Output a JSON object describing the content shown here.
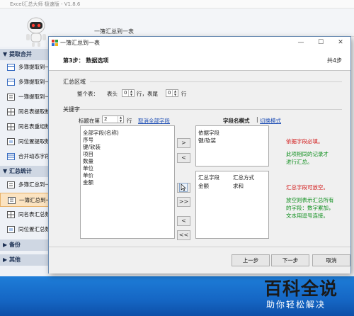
{
  "background": {
    "window_title": "Excel汇总大师 极速版 - V1.8.6",
    "page_title": "一簿汇总到一表",
    "sidebar": {
      "groups": [
        {
          "label": "▼ 提取合并"
        },
        {
          "label": "▼ 汇总统计"
        },
        {
          "label": "▶ 备份"
        },
        {
          "label": "▶ 其他"
        }
      ],
      "items": [
        {
          "label": "多簿提取到一表"
        },
        {
          "label": "多簿提取到一簿"
        },
        {
          "label": "一簿提取到一表"
        },
        {
          "label": "同名表提取数据"
        },
        {
          "label": "同名表重组数据"
        },
        {
          "label": "同位置提取数据"
        },
        {
          "label": "合并动态字段"
        },
        {
          "label": "多簿汇总到一表"
        },
        {
          "label": "一簿汇总到一表"
        },
        {
          "label": "同名表汇总数据"
        },
        {
          "label": "同位置汇总数据"
        }
      ]
    }
  },
  "dialog": {
    "title": "一簿汇总到一表",
    "step_title": "第3步： 数据选项",
    "step_count": "共4步",
    "summary_area": {
      "title": "汇总区域",
      "label_table": "整个表：",
      "label_header": "表头",
      "header_value": "0",
      "label_row1": "行，表尾",
      "footer_value": "0",
      "label_row2": "行"
    },
    "keywords": {
      "title": "关键字",
      "title_row_label": "标题在第",
      "title_row_value": "2",
      "title_row_unit": "行",
      "deselect_all": "取消全部字段",
      "mode_label": "字段名模式",
      "switch_mode": "切换模式",
      "available_fields": [
        "全部字段(名称)",
        "序号",
        "键/软装",
        "项目",
        "数量",
        "单位",
        "单价",
        "金额"
      ],
      "group_fields": [
        "依据字段",
        "键/软装"
      ],
      "summary_header": [
        "汇总字段",
        "汇总方式"
      ],
      "summary_rows": [
        [
          "金额",
          "求和"
        ]
      ],
      "note_group_required": "依据字段必填。",
      "note_group_desc": [
        "此项相同的记录才",
        "进行汇总。"
      ],
      "note_summary_optional": "汇总字段可放空。",
      "note_summary_desc": [
        "放空则表示汇总所有",
        "的字段：数字累加，",
        "文本用逗号连接。"
      ]
    },
    "buttons": {
      "move_right": ">",
      "move_left": "<",
      "move_right2": ">",
      "move_all_right": ">>",
      "move_left2": "<",
      "move_all_left": "<<",
      "prev": "上一步",
      "next": "下一步",
      "cancel": "取消"
    }
  },
  "watermark": {
    "main": "百科全说",
    "sub": "助你轻松解决"
  }
}
